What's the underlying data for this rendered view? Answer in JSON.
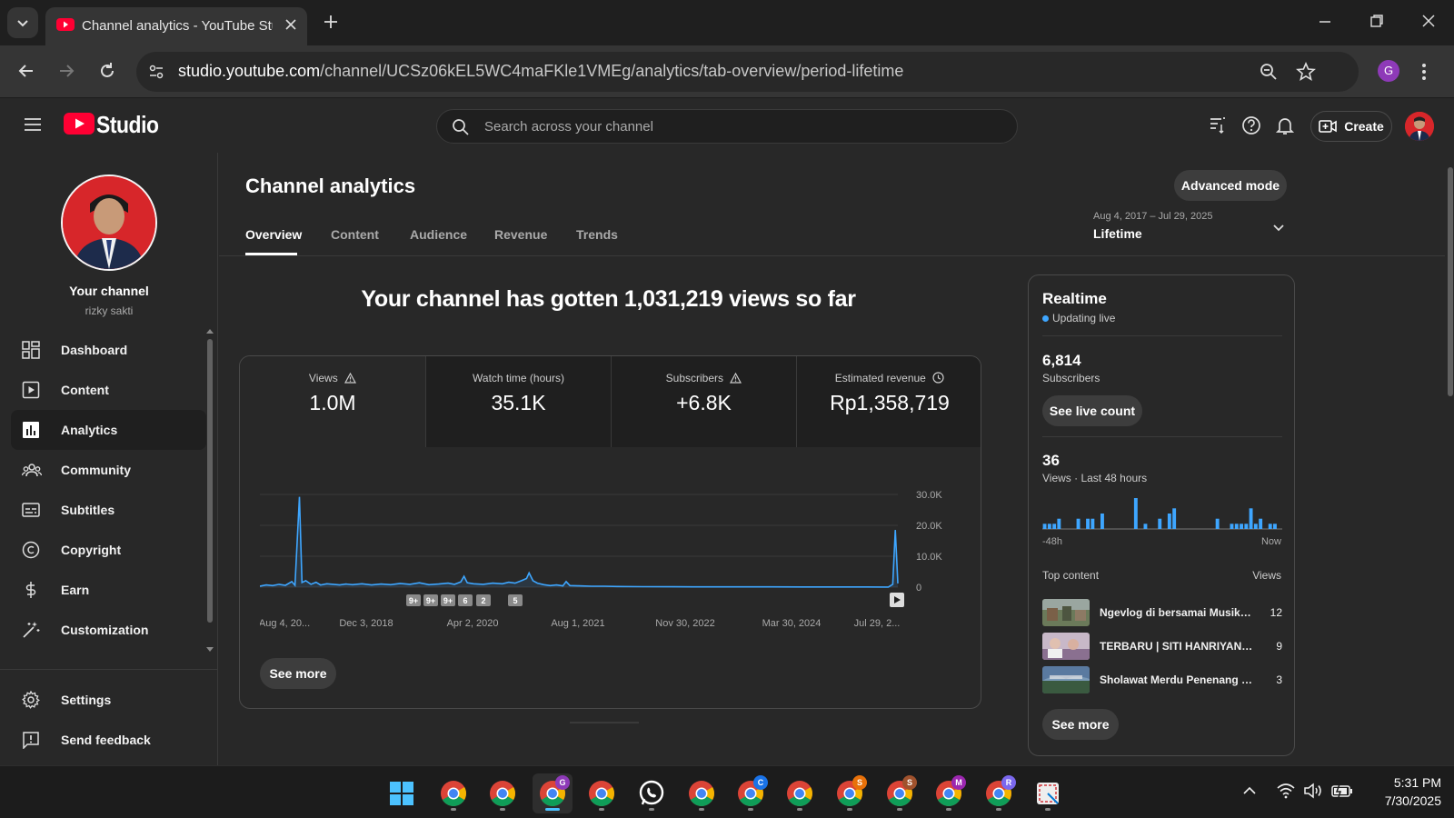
{
  "browser": {
    "tab_title": "Channel analytics - YouTube Studio",
    "url_host": "studio.youtube.com",
    "url_path": "/channel/UCSz06kEL5WC4maFKle1VMEg/analytics/tab-overview/period-lifetime",
    "profile_initial": "G"
  },
  "header": {
    "logo_text": "Studio",
    "search_placeholder": "Search across your channel",
    "create_label": "Create"
  },
  "sidebar": {
    "channel_title": "Your channel",
    "channel_handle": "rizky sakti",
    "items": [
      {
        "label": "Dashboard",
        "icon": "dashboard-icon"
      },
      {
        "label": "Content",
        "icon": "content-icon"
      },
      {
        "label": "Analytics",
        "icon": "analytics-icon",
        "active": true
      },
      {
        "label": "Community",
        "icon": "community-icon"
      },
      {
        "label": "Subtitles",
        "icon": "subtitles-icon"
      },
      {
        "label": "Copyright",
        "icon": "copyright-icon"
      },
      {
        "label": "Earn",
        "icon": "earn-icon"
      },
      {
        "label": "Customization",
        "icon": "customization-icon"
      }
    ],
    "bottom_items": [
      {
        "label": "Settings",
        "icon": "gear-icon"
      },
      {
        "label": "Send feedback",
        "icon": "feedback-icon"
      }
    ]
  },
  "main": {
    "title": "Channel analytics",
    "advanced_mode_label": "Advanced mode",
    "tabs": [
      {
        "label": "Overview",
        "active": true
      },
      {
        "label": "Content"
      },
      {
        "label": "Audience"
      },
      {
        "label": "Revenue"
      },
      {
        "label": "Trends"
      }
    ],
    "period_range": "Aug 4, 2017 – Jul 29, 2025",
    "period_label": "Lifetime",
    "headline": "Your channel has gotten 1,031,219 views so far",
    "metrics": [
      {
        "label": "Views",
        "value": "1.0M",
        "icon": "warning-icon"
      },
      {
        "label": "Watch time (hours)",
        "value": "35.1K"
      },
      {
        "label": "Subscribers",
        "value": "+6.8K",
        "icon": "warning-icon"
      },
      {
        "label": "Estimated revenue",
        "value": "Rp1,358,719",
        "icon": "clock-icon"
      }
    ],
    "see_more_label": "See more",
    "markers": [
      "9+",
      "9+",
      "9+",
      "6",
      "2",
      "5"
    ]
  },
  "chart_data": {
    "type": "line",
    "series_color": "#3ea6ff",
    "x_tick_labels": [
      "Aug 4, 20...",
      "Dec 3, 2018",
      "Apr 2, 2020",
      "Aug 1, 2021",
      "Nov 30, 2022",
      "Mar 30, 2024",
      "Jul 29, 2..."
    ],
    "y_tick_labels": [
      "30.0K",
      "20.0K",
      "10.0K",
      "0"
    ],
    "ylim": [
      0,
      30000
    ],
    "points": [
      [
        0.0,
        300
      ],
      [
        0.01,
        700
      ],
      [
        0.02,
        500
      ],
      [
        0.03,
        900
      ],
      [
        0.04,
        600
      ],
      [
        0.05,
        1800
      ],
      [
        0.055,
        600
      ],
      [
        0.062,
        29200
      ],
      [
        0.066,
        1500
      ],
      [
        0.072,
        2100
      ],
      [
        0.08,
        900
      ],
      [
        0.088,
        1600
      ],
      [
        0.095,
        700
      ],
      [
        0.105,
        1100
      ],
      [
        0.115,
        900
      ],
      [
        0.125,
        700
      ],
      [
        0.135,
        1000
      ],
      [
        0.145,
        800
      ],
      [
        0.16,
        1100
      ],
      [
        0.175,
        700
      ],
      [
        0.19,
        1000
      ],
      [
        0.205,
        800
      ],
      [
        0.22,
        1200
      ],
      [
        0.235,
        900
      ],
      [
        0.25,
        1400
      ],
      [
        0.265,
        800
      ],
      [
        0.28,
        1000
      ],
      [
        0.295,
        1300
      ],
      [
        0.305,
        900
      ],
      [
        0.315,
        1700
      ],
      [
        0.32,
        3500
      ],
      [
        0.325,
        1400
      ],
      [
        0.335,
        1100
      ],
      [
        0.35,
        900
      ],
      [
        0.365,
        1300
      ],
      [
        0.38,
        1100
      ],
      [
        0.39,
        1600
      ],
      [
        0.4,
        1300
      ],
      [
        0.41,
        2100
      ],
      [
        0.418,
        2800
      ],
      [
        0.422,
        4600
      ],
      [
        0.428,
        2100
      ],
      [
        0.435,
        1300
      ],
      [
        0.445,
        800
      ],
      [
        0.455,
        500
      ],
      [
        0.465,
        700
      ],
      [
        0.475,
        400
      ],
      [
        0.48,
        1800
      ],
      [
        0.486,
        500
      ],
      [
        0.5,
        400
      ],
      [
        0.52,
        300
      ],
      [
        0.54,
        300
      ],
      [
        0.56,
        200
      ],
      [
        0.6,
        150
      ],
      [
        0.65,
        120
      ],
      [
        0.7,
        100
      ],
      [
        0.75,
        90
      ],
      [
        0.8,
        80
      ],
      [
        0.85,
        70
      ],
      [
        0.9,
        60
      ],
      [
        0.95,
        50
      ],
      [
        0.985,
        40
      ],
      [
        0.992,
        900
      ],
      [
        0.996,
        18500
      ],
      [
        1.0,
        1200
      ]
    ]
  },
  "realtime": {
    "title": "Realtime",
    "live_label": "Updating live",
    "subscribers_value": "6,814",
    "subscribers_label": "Subscribers",
    "see_live_count_label": "See live count",
    "views_value": "36",
    "views_label": "Views · Last 48 hours",
    "axis_start": "-48h",
    "axis_end": "Now",
    "bars": [
      1,
      1,
      1,
      2,
      0,
      0,
      0,
      2,
      0,
      2,
      2,
      0,
      3,
      0,
      0,
      0,
      0,
      0,
      0,
      6,
      0,
      1,
      0,
      0,
      2,
      0,
      3,
      4,
      0,
      0,
      0,
      0,
      0,
      0,
      0,
      0,
      2,
      0,
      0,
      1,
      1,
      1,
      1,
      4,
      1,
      2,
      0,
      1,
      1,
      0
    ],
    "top_content_label": "Top content",
    "top_views_label": "Views",
    "top_content": [
      {
        "title": "Ngevlog di bersamai Musik religi",
        "views": "12"
      },
      {
        "title": "TERBARU | SITI HANRIYANTI ...",
        "views": "9"
      },
      {
        "title": "Sholawat Merdu Penenang Jiwa",
        "views": "3"
      }
    ],
    "see_more_label": "See more"
  },
  "taskbar": {
    "time": "5:31 PM",
    "date": "7/30/2025",
    "badges": [
      "G",
      "C",
      "S",
      "S",
      "M",
      "R"
    ]
  },
  "colors": {
    "accent": "#3ea6ff",
    "youtube_red": "#ff0033",
    "bg": "#282828"
  }
}
